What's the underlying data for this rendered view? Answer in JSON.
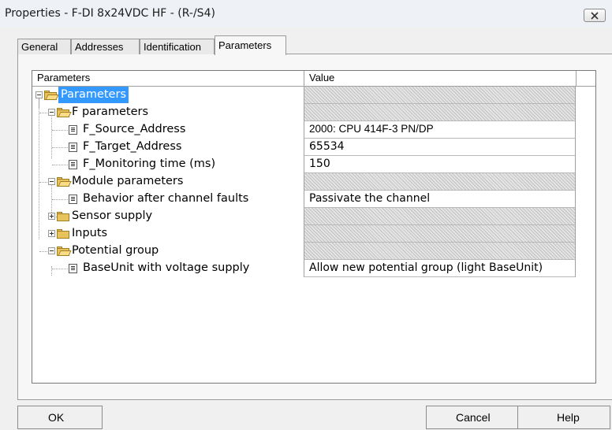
{
  "window": {
    "title": "Properties - F-DI 8x24VDC HF - (R-/S4)"
  },
  "tabs": [
    {
      "label": "General"
    },
    {
      "label": "Addresses"
    },
    {
      "label": "Identification"
    },
    {
      "label": "Parameters",
      "active": true
    }
  ],
  "table": {
    "columns": [
      "Parameters",
      "Value"
    ],
    "rows": [
      {
        "label": "Parameters",
        "value": "",
        "icon": "folder-open-icon",
        "expander": "minus",
        "selected": true
      },
      {
        "label": "F parameters",
        "value": "",
        "icon": "folder-open-icon",
        "expander": "minus"
      },
      {
        "label": "F_Source_Address",
        "value": "2000: CPU 414F-3 PN/DP",
        "icon": "parameter-icon"
      },
      {
        "label": "F_Target_Address",
        "value": "65534",
        "icon": "parameter-icon"
      },
      {
        "label": "F_Monitoring time (ms)",
        "value": "150",
        "icon": "parameter-icon"
      },
      {
        "label": "Module parameters",
        "value": "",
        "icon": "folder-open-icon",
        "expander": "minus"
      },
      {
        "label": "Behavior after channel faults",
        "value": "Passivate the channel",
        "icon": "parameter-icon"
      },
      {
        "label": "Sensor supply",
        "value": "",
        "icon": "folder-closed-icon",
        "expander": "plus"
      },
      {
        "label": "Inputs",
        "value": "",
        "icon": "folder-closed-icon",
        "expander": "plus"
      },
      {
        "label": "Potential group",
        "value": "",
        "icon": "folder-open-icon",
        "expander": "minus"
      },
      {
        "label": "BaseUnit with voltage supply",
        "value": "Allow new potential group (light BaseUnit)",
        "icon": "parameter-icon"
      }
    ]
  },
  "buttons": {
    "ok": "OK",
    "cancel": "Cancel",
    "help": "Help"
  },
  "colors": {
    "selection": "#3399ff",
    "window_bg": "#f0f0f0",
    "titlebar_bg": "#eef2f7",
    "readonly_hatch": "#c2c2c2"
  }
}
